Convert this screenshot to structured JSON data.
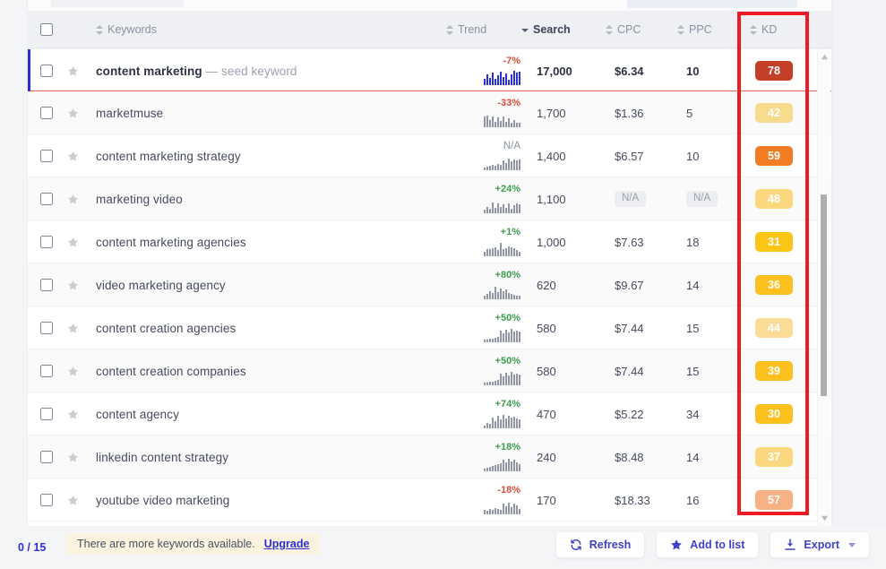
{
  "table": {
    "columns": [
      {
        "key": "keywords",
        "label": "Keywords",
        "sort": "both",
        "active": false
      },
      {
        "key": "trend",
        "label": "Trend",
        "sort": "both",
        "active": false
      },
      {
        "key": "search",
        "label": "Search",
        "sort": "desc",
        "active": true
      },
      {
        "key": "cpc",
        "label": "CPC",
        "sort": "both",
        "active": false
      },
      {
        "key": "ppc",
        "label": "PPC",
        "sort": "both",
        "active": false
      },
      {
        "key": "kd",
        "label": "KD",
        "sort": "both",
        "active": false
      }
    ],
    "rows": [
      {
        "keyword": "content marketing",
        "suffix": "— seed keyword",
        "seed": true,
        "trend_pct": "-7%",
        "trend_dir": "down",
        "spark": [
          7,
          12,
          8,
          14,
          7,
          11,
          15,
          9,
          13,
          6,
          12,
          16,
          14,
          15
        ],
        "search": "17,000",
        "cpc": "$6.34",
        "ppc": "10",
        "kd": "78",
        "kd_color": "#c43f28",
        "kd_text": "#ffffff"
      },
      {
        "keyword": "marketmuse",
        "suffix": "",
        "seed": false,
        "trend_pct": "-33%",
        "trend_dir": "down",
        "spark": [
          12,
          13,
          8,
          12,
          6,
          11,
          7,
          12,
          6,
          10,
          5,
          8,
          5,
          5
        ],
        "search": "1,700",
        "cpc": "$1.36",
        "ppc": "5",
        "kd": "42",
        "kd_color": "#f8dc8d",
        "kd_text": "#ffffff"
      },
      {
        "keyword": "content marketing strategy",
        "suffix": "",
        "seed": false,
        "trend_pct": "N/A",
        "trend_dir": "na",
        "spark": [
          3,
          4,
          5,
          6,
          5,
          7,
          6,
          11,
          8,
          13,
          10,
          12,
          11,
          12
        ],
        "search": "1,400",
        "cpc": "$6.57",
        "ppc": "10",
        "kd": "59",
        "kd_color": "#f07d24",
        "kd_text": "#ffffff"
      },
      {
        "keyword": "marketing video",
        "suffix": "",
        "seed": false,
        "trend_pct": "+24%",
        "trend_dir": "up",
        "spark": [
          4,
          7,
          5,
          12,
          6,
          11,
          7,
          10,
          6,
          11,
          5,
          9,
          11,
          10
        ],
        "search": "1,100",
        "cpc": "N/A",
        "ppc": "N/A",
        "kd": "48",
        "kd_color": "#fbd77f",
        "kd_text": "#ffffff"
      },
      {
        "keyword": "content marketing agencies",
        "suffix": "",
        "seed": false,
        "trend_pct": "+1%",
        "trend_dir": "up",
        "spark": [
          5,
          8,
          8,
          9,
          10,
          7,
          15,
          8,
          9,
          11,
          10,
          9,
          7,
          5
        ],
        "search": "1,000",
        "cpc": "$7.63",
        "ppc": "18",
        "kd": "31",
        "kd_color": "#fcc516",
        "kd_text": "#ffffff"
      },
      {
        "keyword": "video marketing agency",
        "suffix": "",
        "seed": false,
        "trend_pct": "+80%",
        "trend_dir": "up",
        "spark": [
          4,
          6,
          9,
          7,
          14,
          8,
          12,
          9,
          11,
          7,
          6,
          5,
          4,
          4
        ],
        "search": "620",
        "cpc": "$9.67",
        "ppc": "14",
        "kd": "36",
        "kd_color": "#fbc01d",
        "kd_text": "#ffffff"
      },
      {
        "keyword": "content creation agencies",
        "suffix": "",
        "seed": false,
        "trend_pct": "+50%",
        "trend_dir": "up",
        "spark": [
          3,
          3,
          4,
          4,
          5,
          6,
          13,
          10,
          14,
          11,
          15,
          12,
          13,
          12
        ],
        "search": "580",
        "cpc": "$7.44",
        "ppc": "15",
        "kd": "44",
        "kd_color": "#fbdb95",
        "kd_text": "#ffffff"
      },
      {
        "keyword": "content creation companies",
        "suffix": "",
        "seed": false,
        "trend_pct": "+50%",
        "trend_dir": "up",
        "spark": [
          3,
          3,
          4,
          4,
          5,
          6,
          13,
          10,
          14,
          11,
          15,
          12,
          13,
          12
        ],
        "search": "580",
        "cpc": "$7.44",
        "ppc": "15",
        "kd": "39",
        "kd_color": "#fbc01d",
        "kd_text": "#ffffff"
      },
      {
        "keyword": "content agency",
        "suffix": "",
        "seed": false,
        "trend_pct": "+74%",
        "trend_dir": "up",
        "spark": [
          3,
          6,
          5,
          12,
          8,
          14,
          10,
          15,
          11,
          14,
          12,
          13,
          11,
          10
        ],
        "search": "470",
        "cpc": "$5.22",
        "ppc": "34",
        "kd": "30",
        "kd_color": "#fbc01d",
        "kd_text": "#ffffff"
      },
      {
        "keyword": "linkedin content strategy",
        "suffix": "",
        "seed": false,
        "trend_pct": "+18%",
        "trend_dir": "up",
        "spark": [
          3,
          4,
          5,
          6,
          7,
          8,
          9,
          13,
          10,
          14,
          11,
          13,
          10,
          8
        ],
        "search": "240",
        "cpc": "$8.48",
        "ppc": "14",
        "kd": "37",
        "kd_color": "#fbd77f",
        "kd_text": "#ffffff"
      },
      {
        "keyword": "youtube video marketing",
        "suffix": "",
        "seed": false,
        "trend_pct": "-18%",
        "trend_dir": "down",
        "spark": [
          5,
          4,
          6,
          5,
          7,
          6,
          5,
          12,
          9,
          13,
          8,
          12,
          10,
          6
        ],
        "search": "170",
        "cpc": "$18.33",
        "ppc": "16",
        "kd": "57",
        "kd_color": "#f6b184",
        "kd_text": "#ffffff"
      }
    ]
  },
  "footer": {
    "counter": "0 / 15",
    "notice_text": "There are more keywords available.",
    "upgrade_label": "Upgrade",
    "buttons": [
      {
        "key": "refresh",
        "label": "Refresh",
        "icon": "refresh-icon"
      },
      {
        "key": "add_to_list",
        "label": "Add to list",
        "icon": "star-icon"
      },
      {
        "key": "export",
        "label": "Export",
        "icon": "download-icon",
        "caret": true
      }
    ]
  },
  "annotation": {
    "color": "#ed1b24",
    "target": "kd-column"
  }
}
